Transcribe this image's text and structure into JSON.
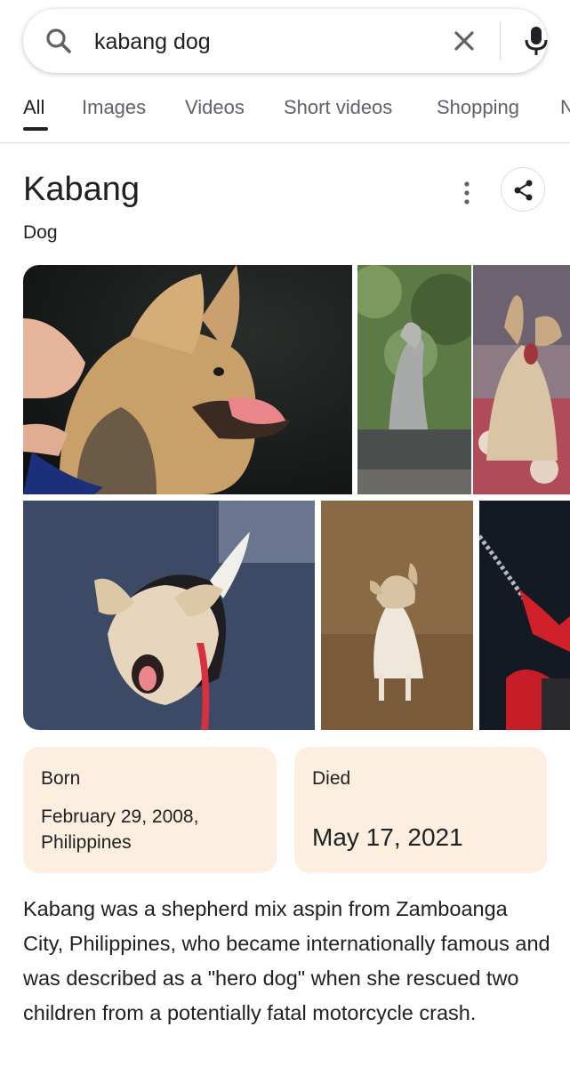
{
  "search": {
    "query": "kabang dog",
    "icons": [
      "search-icon",
      "clear-icon",
      "mic-icon"
    ]
  },
  "tabs": [
    {
      "label": "All",
      "active": true
    },
    {
      "label": "Images",
      "active": false
    },
    {
      "label": "Videos",
      "active": false
    },
    {
      "label": "Short videos",
      "active": false
    },
    {
      "label": "Shopping",
      "active": false
    },
    {
      "label": "N",
      "active": false
    }
  ],
  "entity": {
    "title": "Kabang",
    "subtitle": "Dog"
  },
  "images": [
    {
      "subject": "Chihuahua-like dog with tongue out, held by a hand"
    },
    {
      "subject": "Dog statue on pedestal among trees"
    },
    {
      "subject": "Dog on floral couch"
    },
    {
      "subject": "Dog on blue carpet with red leash"
    },
    {
      "subject": "Dog sitting on brown floor"
    },
    {
      "subject": "Red leash and chain, dark background"
    }
  ],
  "facts": {
    "born": {
      "label": "Born",
      "value": "February 29, 2008, Philippines"
    },
    "died": {
      "label": "Died",
      "value": "May 17, 2021"
    }
  },
  "description": "Kabang was a shepherd mix aspin from Zamboanga City, Philippines, who became internationally famous and was described as a \"hero dog\" when she rescued two children from a potentially fatal motorcycle crash.",
  "colors": {
    "fact_card_bg": "#fdefdf",
    "text": "#202124",
    "muted": "#5f6368",
    "divider": "#dadce0"
  }
}
